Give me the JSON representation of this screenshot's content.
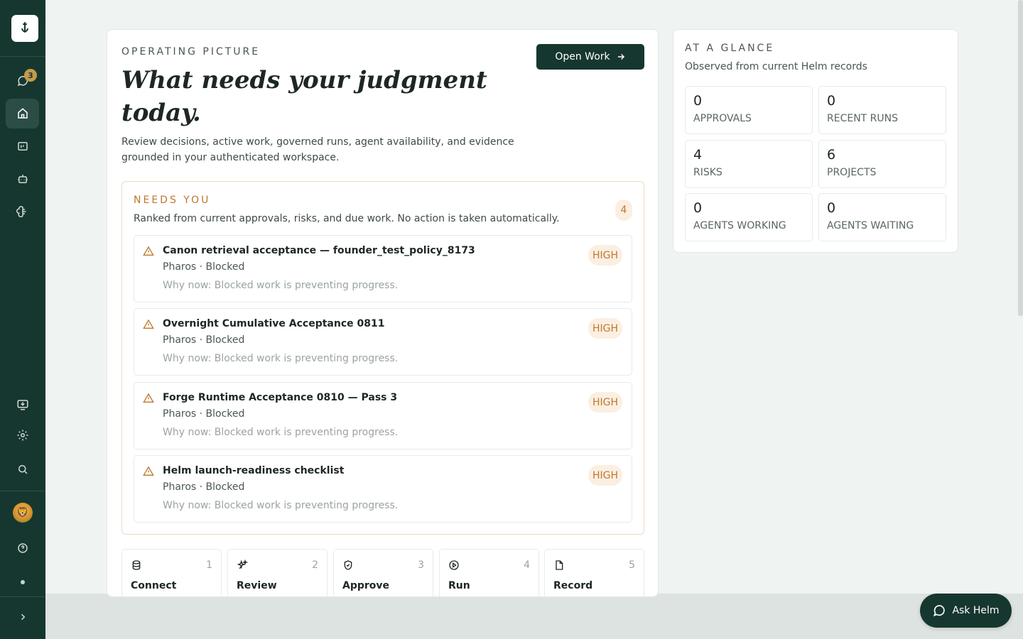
{
  "sidebar": {
    "notification_count": "3",
    "items": [
      {
        "name": "messages"
      },
      {
        "name": "home"
      },
      {
        "name": "projects"
      },
      {
        "name": "agents"
      },
      {
        "name": "canon"
      },
      {
        "name": "install"
      },
      {
        "name": "settings"
      },
      {
        "name": "search"
      }
    ]
  },
  "header": {
    "eyebrow": "OPERATING PICTURE",
    "title": "What needs your judgment today.",
    "subtitle": "Review decisions, active work, governed runs, agent availability, and evidence grounded in your authenticated workspace.",
    "open_work_label": "Open Work"
  },
  "needs_you": {
    "title": "NEEDS YOU",
    "description": "Ranked from current approvals, risks, and due work. No action is taken automatically.",
    "count": "4",
    "items": [
      {
        "title": "Canon retrieval acceptance — founder_test_policy_8173",
        "meta": "Pharos · Blocked",
        "why": "Why now: Blocked work is preventing progress.",
        "severity": "HIGH"
      },
      {
        "title": "Overnight Cumulative Acceptance 0811",
        "meta": "Pharos · Blocked",
        "why": "Why now: Blocked work is preventing progress.",
        "severity": "HIGH"
      },
      {
        "title": "Forge Runtime Acceptance 0810 — Pass 3",
        "meta": "Pharos · Blocked",
        "why": "Why now: Blocked work is preventing progress.",
        "severity": "HIGH"
      },
      {
        "title": "Helm launch-readiness checklist",
        "meta": "Pharos · Blocked",
        "why": "Why now: Blocked work is preventing progress.",
        "severity": "HIGH"
      }
    ]
  },
  "steps": [
    {
      "label": "Connect",
      "num": "1",
      "icon": "database-icon"
    },
    {
      "label": "Review",
      "num": "2",
      "icon": "sparkles-icon"
    },
    {
      "label": "Approve",
      "num": "3",
      "icon": "shield-check-icon"
    },
    {
      "label": "Run",
      "num": "4",
      "icon": "play-circle-icon"
    },
    {
      "label": "Record",
      "num": "5",
      "icon": "file-icon"
    }
  ],
  "glance": {
    "title": "AT A GLANCE",
    "subtitle": "Observed from current Helm records",
    "stats": [
      {
        "value": "0",
        "label": "APPROVALS"
      },
      {
        "value": "0",
        "label": "RECENT RUNS"
      },
      {
        "value": "4",
        "label": "RISKS"
      },
      {
        "value": "6",
        "label": "PROJECTS"
      },
      {
        "value": "0",
        "label": "AGENTS WORKING"
      },
      {
        "value": "0",
        "label": "AGENTS WAITING"
      }
    ]
  },
  "ask_label": "Ask Helm",
  "colors": {
    "sidebar": "#16372f",
    "accent": "#c0772f",
    "badge": "#c59a4a",
    "background": "#eff3f2"
  }
}
